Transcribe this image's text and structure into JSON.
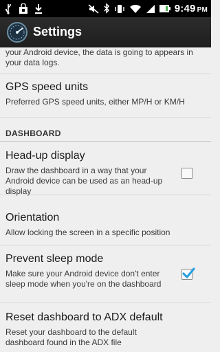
{
  "status_bar": {
    "time": "9:49",
    "time_suffix": "PM",
    "left_icons": [
      "usb-icon",
      "shopping-bag-icon",
      "download-icon"
    ],
    "right_icons": [
      "mute-icon",
      "bluetooth-icon",
      "vibrate-icon",
      "wifi-icon",
      "signal-icon",
      "battery-icon"
    ]
  },
  "action_bar": {
    "title": "Settings",
    "app_icon": "speedometer-icon"
  },
  "list": {
    "partial_summary": "your Android device, the data is going to appears in your data logs.",
    "gps_units": {
      "title": "GPS speed units",
      "summary": "Preferred GPS speed units, either MP/H or KM/H"
    },
    "dashboard_category": "DASHBOARD",
    "headup": {
      "title": "Head-up display",
      "summary": "Draw the dashboard in a way that your Android device can be used as an head-up display",
      "checked": false
    },
    "orientation": {
      "title": "Orientation",
      "summary": "Allow locking the screen in a specific position"
    },
    "prevent_sleep": {
      "title": "Prevent sleep mode",
      "summary": "Make sure your Android device don't enter sleep mode when you're on the dashboard",
      "checked": true
    },
    "reset_dashboard": {
      "title": "Reset dashboard to ADX default",
      "summary": "Reset your dashboard to the default dashboard found in the ADX file"
    }
  },
  "colors": {
    "check_blue": "#2a9fe0",
    "background": "#efefef"
  }
}
